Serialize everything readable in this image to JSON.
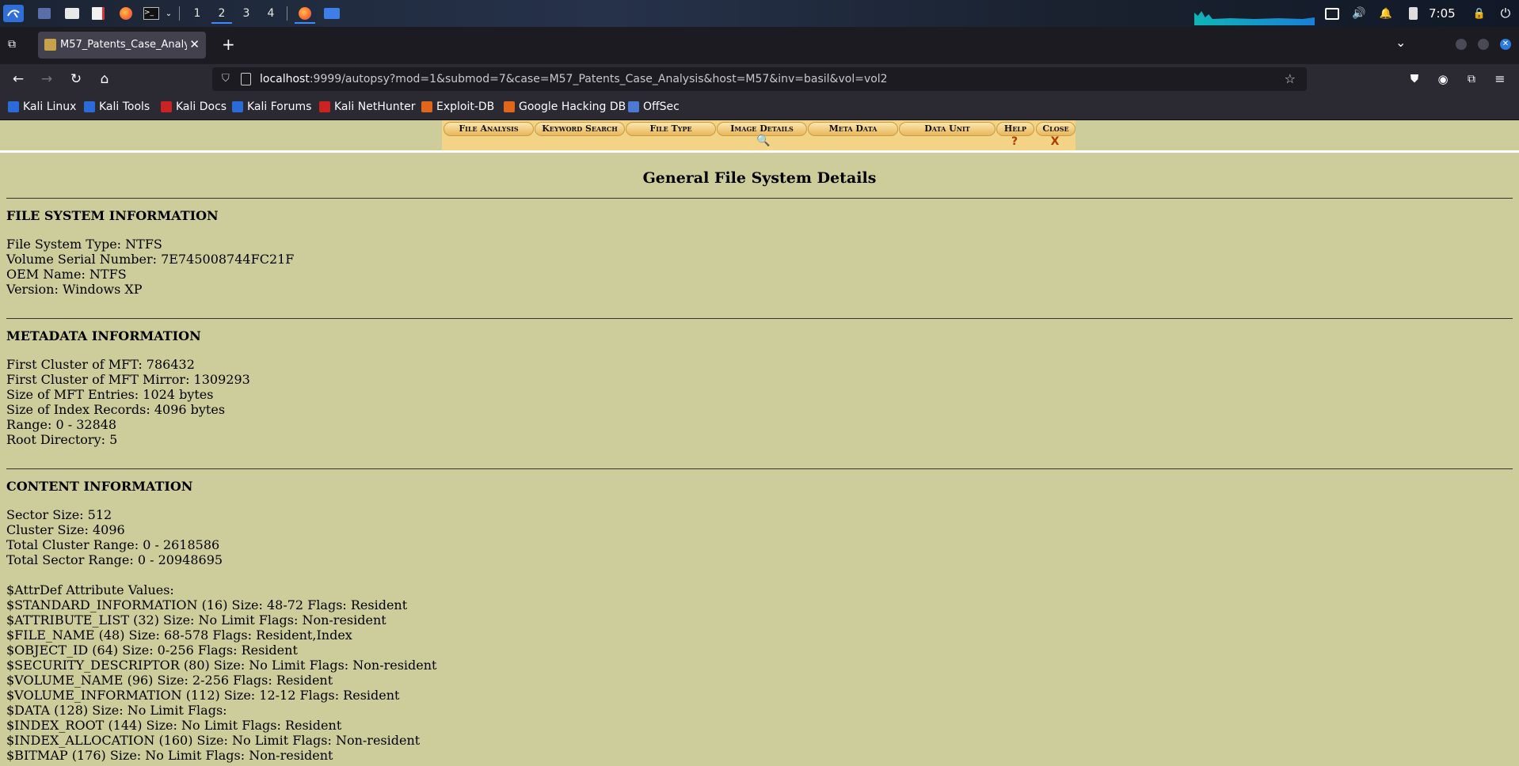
{
  "system": {
    "workspaces": [
      "1",
      "2",
      "3",
      "4"
    ],
    "active_workspace": "2",
    "clock": "7:05"
  },
  "browser": {
    "tab_title": "M57_Patents_Case_Analy",
    "url_host": "localhost",
    "url_rest": ":9999/autopsy?mod=1&submod=7&case=M57_Patents_Case_Analysis&host=M57&inv=basil&vol=vol2",
    "bookmarks": [
      {
        "label": "Kali Linux",
        "color": "#2a6bd8"
      },
      {
        "label": "Kali Tools",
        "color": "#2a6bd8"
      },
      {
        "label": "Kali Docs",
        "color": "#cc2222"
      },
      {
        "label": "Kali Forums",
        "color": "#2a6bd8"
      },
      {
        "label": "Kali NetHunter",
        "color": "#cc2222"
      },
      {
        "label": "Exploit-DB",
        "color": "#e0661a"
      },
      {
        "label": "Google Hacking DB",
        "color": "#e0661a"
      },
      {
        "label": "OffSec",
        "color": "#4a7bd0"
      }
    ]
  },
  "menu": {
    "file_analysis": "File Analysis",
    "keyword_search": "Keyword Search",
    "file_type": "File Type",
    "image_details": "Image Details",
    "meta_data": "Meta Data",
    "data_unit": "Data Unit",
    "help": "Help",
    "close": "Close",
    "help_sub": "?",
    "close_sub": "X"
  },
  "page": {
    "title": "General File System Details",
    "sections": [
      {
        "heading": "FILE SYSTEM INFORMATION",
        "lines": [
          "File System Type: NTFS",
          "Volume Serial Number: 7E745008744FC21F",
          "OEM Name: NTFS",
          "Version: Windows XP"
        ]
      },
      {
        "heading": "METADATA INFORMATION",
        "lines": [
          "First Cluster of MFT: 786432",
          "First Cluster of MFT Mirror: 1309293",
          "Size of MFT Entries: 1024 bytes",
          "Size of Index Records: 4096 bytes",
          "Range: 0 - 32848",
          "Root Directory: 5"
        ]
      },
      {
        "heading": "CONTENT INFORMATION",
        "lines": [
          "Sector Size: 512",
          "Cluster Size: 4096",
          "Total Cluster Range: 0 - 2618586",
          "Total Sector Range: 0 - 20948695",
          "",
          "$AttrDef Attribute Values:",
          "$STANDARD_INFORMATION (16) Size: 48-72 Flags: Resident",
          "$ATTRIBUTE_LIST (32) Size: No Limit Flags: Non-resident",
          "$FILE_NAME (48) Size: 68-578 Flags: Resident,Index",
          "$OBJECT_ID (64) Size: 0-256 Flags: Resident",
          "$SECURITY_DESCRIPTOR (80) Size: No Limit Flags: Non-resident",
          "$VOLUME_NAME (96) Size: 2-256 Flags: Resident",
          "$VOLUME_INFORMATION (112) Size: 12-12 Flags: Resident",
          "$DATA (128) Size: No Limit Flags:",
          "$INDEX_ROOT (144) Size: No Limit Flags: Resident",
          "$INDEX_ALLOCATION (160) Size: No Limit Flags: Non-resident",
          "$BITMAP (176) Size: No Limit Flags: Non-resident"
        ]
      }
    ]
  }
}
